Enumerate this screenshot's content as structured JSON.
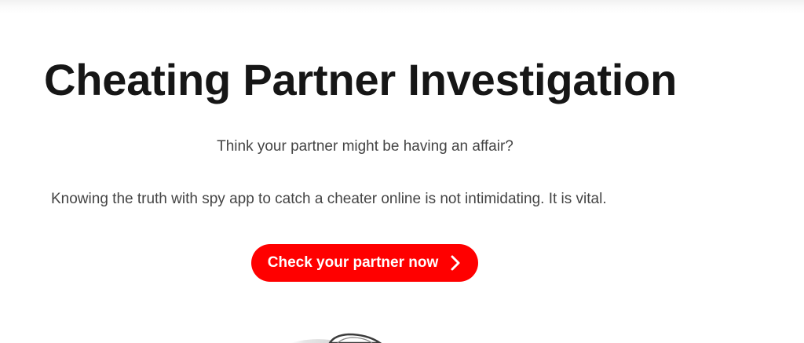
{
  "hero": {
    "title": "Cheating Partner Investigation",
    "question": "Think your partner might be having an affair?",
    "statement": "Knowing the truth with spy app to catch a cheater online is not intimidating. It is vital."
  },
  "cta": {
    "label": "Check your partner now",
    "icon": "chevron-right-icon",
    "background_color": "#ff0000",
    "text_color": "#ffffff"
  },
  "colors": {
    "title": "#161616",
    "body_text": "#444444",
    "page_background": "#ffffff"
  }
}
